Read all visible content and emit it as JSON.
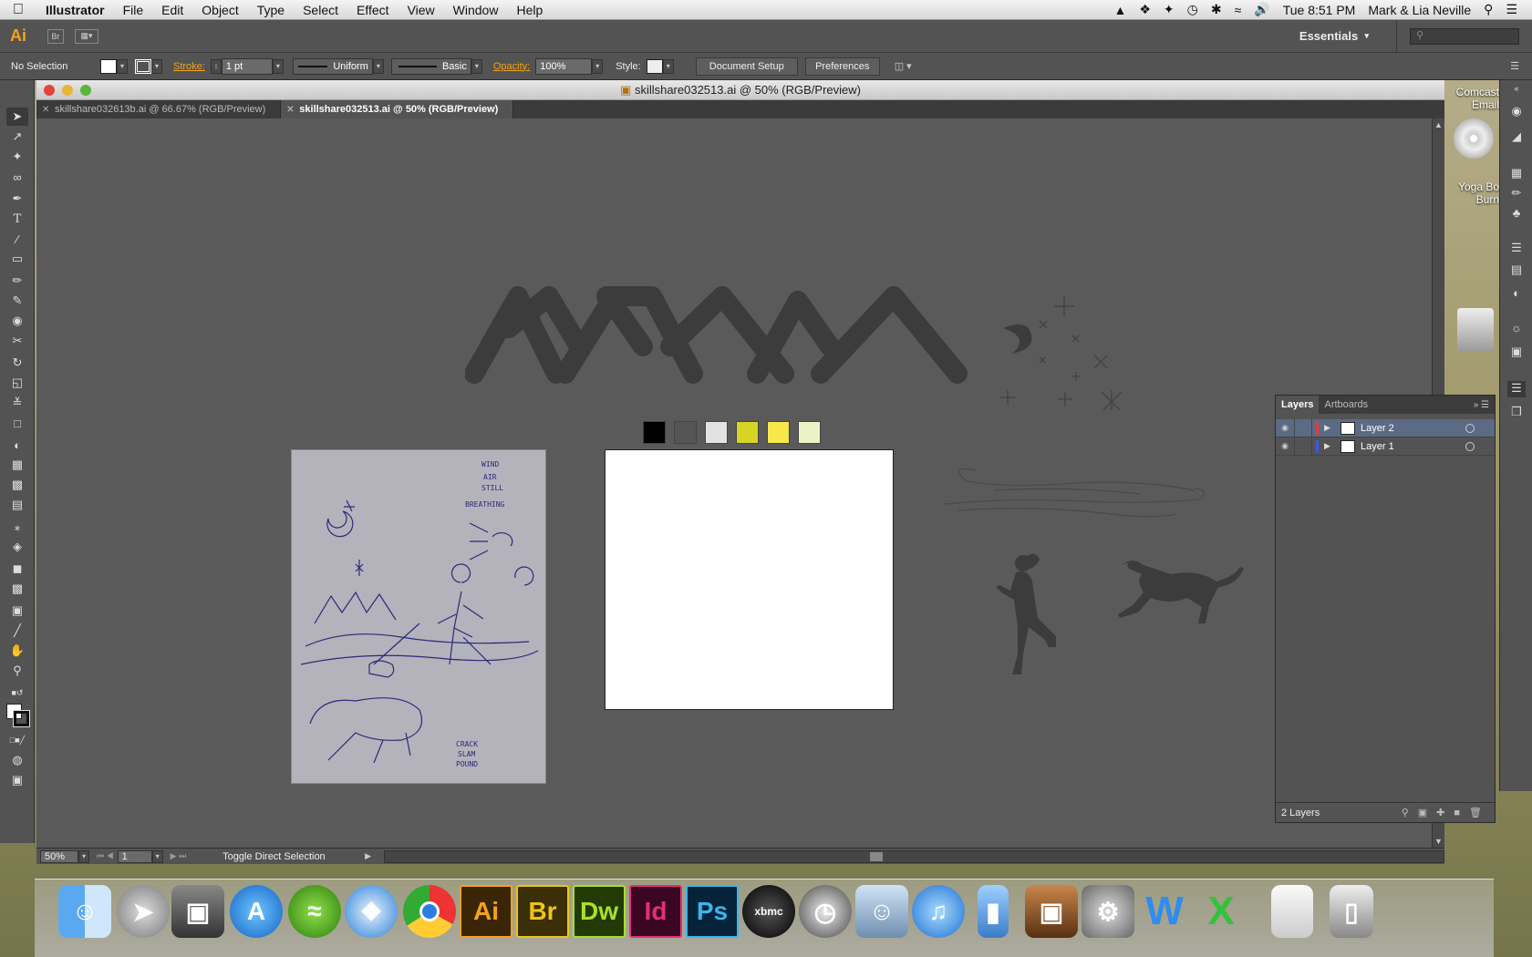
{
  "menubar": {
    "app": "Illustrator",
    "items": [
      "File",
      "Edit",
      "Object",
      "Type",
      "Select",
      "Effect",
      "View",
      "Window",
      "Help"
    ],
    "clock": "Tue 8:51 PM",
    "user": "Mark & Lia Neville"
  },
  "appbar": {
    "logo": "Ai",
    "bridge": "Br",
    "workspace": "Essentials"
  },
  "controlbar": {
    "selection": "No Selection",
    "stroke_label": "Stroke:",
    "stroke_weight": "1 pt",
    "profile": "Uniform",
    "brush": "Basic",
    "opacity_label": "Opacity:",
    "opacity_value": "100%",
    "style_label": "Style:",
    "document_setup": "Document Setup",
    "preferences": "Preferences"
  },
  "document": {
    "window_title": "skillshare032513.ai @ 50% (RGB/Preview)",
    "tabs": [
      {
        "label": "skillshare032613b.ai @ 66.67% (RGB/Preview)"
      },
      {
        "label": "skillshare032513.ai @ 50% (RGB/Preview)"
      }
    ]
  },
  "canvas": {
    "palette": [
      "#000000",
      "#555555",
      "#e2e2e2",
      "#d6d424",
      "#f6e84a",
      "#ecf2c4"
    ],
    "sketch_notes": [
      "WIND",
      "AIR",
      "STILL",
      "BREATHING",
      "CRACK",
      "SLAM",
      "POUND"
    ]
  },
  "statusbar": {
    "zoom": "50%",
    "artboard": "1",
    "status": "Toggle Direct Selection"
  },
  "layers": {
    "tab_layers": "Layers",
    "tab_artboards": "Artboards",
    "rows": [
      {
        "name": "Layer 2",
        "color": "#e03c3c"
      },
      {
        "name": "Layer 1",
        "color": "#3c5ae0"
      }
    ],
    "count": "2 Layers"
  },
  "desktop": {
    "item1": "Comcast Email",
    "item2": "Yoga Bo Burn"
  },
  "dock": {
    "adobe": [
      {
        "label": "Ai",
        "color": "#f7a21b",
        "bg": "#3a2606"
      },
      {
        "label": "Br",
        "color": "#f0c419",
        "bg": "#3a2f06"
      },
      {
        "label": "Dw",
        "color": "#a8e02d",
        "bg": "#233a06"
      },
      {
        "label": "Id",
        "color": "#e0307a",
        "bg": "#3a0622"
      },
      {
        "label": "Ps",
        "color": "#39b6ef",
        "bg": "#06233a"
      }
    ]
  }
}
